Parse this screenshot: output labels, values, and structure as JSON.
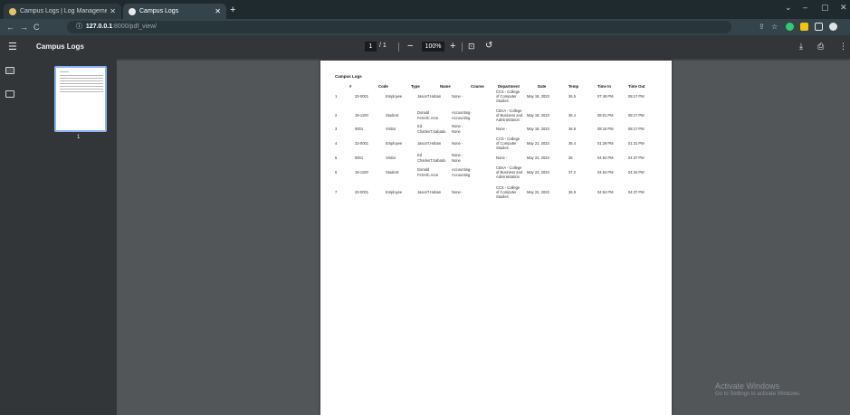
{
  "browser": {
    "tabs": [
      {
        "label": "Campus Logs | Log Managemen",
        "favicon_color": "#e8c262"
      },
      {
        "label": "Campus Logs",
        "favicon_color": "#e8eaed"
      }
    ],
    "new_tab": "+",
    "address": {
      "host": "127.0.0.1",
      "path": ":8000/pdf_view/"
    },
    "window_controls": {
      "minimize": "–",
      "maximize": "▢",
      "close": "✕"
    },
    "accent_colors": {
      "ext_green": "#2ecc71",
      "ext_yellow": "#f1c40f"
    }
  },
  "pdf_viewer": {
    "title": "Campus Logs",
    "current_page": "1",
    "page_total": "/ 1",
    "zoom": "100%",
    "thumbnail_label": "1"
  },
  "document": {
    "title": "Campus Logs",
    "columns": [
      "#",
      "Code",
      "Type",
      "Name",
      "Course",
      "Department",
      "Date",
      "Temp",
      "Time In",
      "Time Out"
    ],
    "rows": [
      {
        "num": "1",
        "code": "23-0001",
        "type": "Employee",
        "name": [
          "JasonT.Haban"
        ],
        "course": [
          "None -"
        ],
        "department": [
          "CCS - College",
          "of Computer",
          "Studies"
        ],
        "date": "May 18, 2023",
        "temp": "36.5",
        "time_in": "07:49 PM",
        "time_out": "08:17 PM"
      },
      {
        "num": "2",
        "code": "19-1100",
        "type": "Student",
        "name": [
          "Donald",
          "FerrelC.Arce"
        ],
        "course": [
          "Accounting-",
          "Accounting"
        ],
        "department": [
          "CBAA - College",
          "of Business and",
          "Administration"
        ],
        "date": "May 18, 2023",
        "temp": "36.4",
        "time_in": "08:01 PM",
        "time_out": "08:17 PM"
      },
      {
        "num": "3",
        "code": "0001",
        "type": "Visitor",
        "name": [
          "Ed",
          "CharlesT.Sabado"
        ],
        "course": [
          "None -",
          "None"
        ],
        "department": [
          "None -"
        ],
        "date": "May 18, 2023",
        "temp": "36.8",
        "time_in": "08:16 PM",
        "time_out": "08:17 PM"
      },
      {
        "num": "4",
        "code": "23-0001",
        "type": "Employee",
        "name": [
          "JasonT.Haban"
        ],
        "course": [
          "None -"
        ],
        "department": [
          "CCS - College",
          "of Computer",
          "Studies"
        ],
        "date": "May 21, 2023",
        "temp": "36.4",
        "time_in": "01:29 PM",
        "time_out": "01:31 PM"
      },
      {
        "num": "5",
        "code": "0001",
        "type": "Visitor",
        "name": [
          "Ed",
          "CharlesT.Sabado"
        ],
        "course": [
          "None -",
          "None"
        ],
        "department": [
          "None -"
        ],
        "date": "May 22, 2023",
        "temp": "36",
        "time_in": "04:52 PM",
        "time_out": "04:37 PM"
      },
      {
        "num": "6",
        "code": "19-1100",
        "type": "Student",
        "name": [
          "Donald",
          "FerrelC.Arce"
        ],
        "course": [
          "Accounting-",
          "Accounting"
        ],
        "department": [
          "CBAA - College",
          "of Business and",
          "Administration"
        ],
        "date": "May 22, 2023",
        "temp": "37.2",
        "time_in": "04:54 PM",
        "time_out": "04:34 PM"
      },
      {
        "num": "7",
        "code": "23-0001",
        "type": "Employee",
        "name": [
          "JasonT.Haban"
        ],
        "course": [
          "None -"
        ],
        "department": [
          "CCS - College",
          "of Computer",
          "Studies"
        ],
        "date": "May 22, 2023",
        "temp": "36.9",
        "time_in": "04:54 PM",
        "time_out": "04:37 PM"
      }
    ]
  },
  "watermark": {
    "line1": "Activate Windows",
    "line2": "Go to Settings to activate Windows."
  }
}
